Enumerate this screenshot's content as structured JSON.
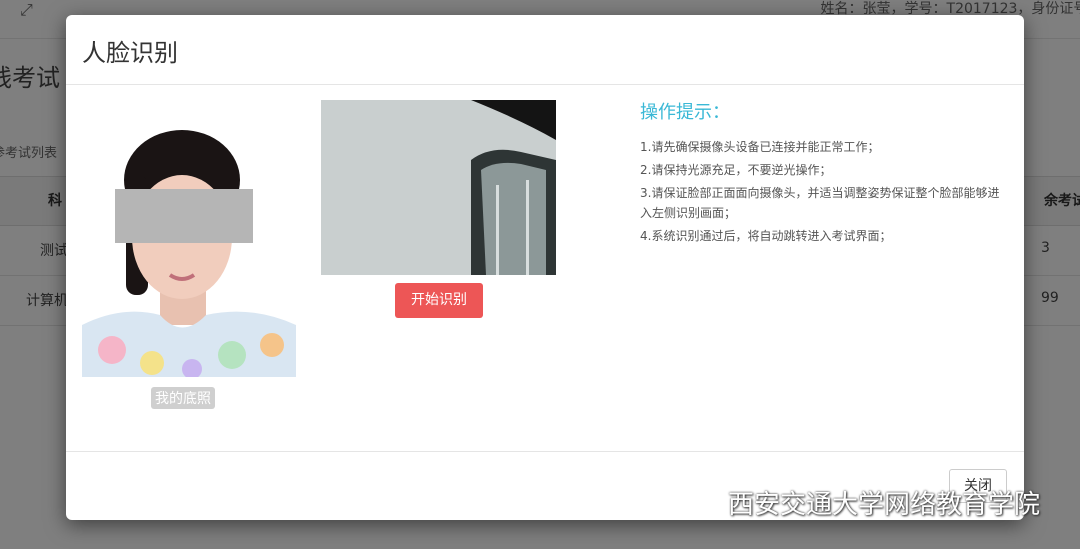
{
  "background_page": {
    "user_info": "姓名：张莹，学号：T2017123，身份证号：T",
    "heading": "线考试",
    "tab": "参考试列表",
    "table_header_left": "科",
    "table_header_right": "余考试次",
    "rows": [
      {
        "name": "测试",
        "count": "3"
      },
      {
        "name": "计算机",
        "count": "99"
      }
    ],
    "expand_icon": "expand-icon"
  },
  "modal": {
    "title": "人脸识别",
    "photo_label": "我的底照",
    "start_button": "开始识别",
    "tips_title": "操作提示：",
    "tips": [
      "1.请先确保摄像头设备已连接并能正常工作；",
      "2.请保持光源充足，不要逆光操作；",
      "3.请保证脸部正面面向摄像头，并适当调整姿势保证整个脸部能够进入左侧识别画面；",
      "4.系统识别通过后，将自动跳转进入考试界面；"
    ],
    "close_button": "关闭",
    "accent_color": "#3ab8d6",
    "button_color": "#ed5656"
  },
  "watermark": {
    "icon": "wechat-icon",
    "text": "西安交通大学网络教育学院"
  }
}
